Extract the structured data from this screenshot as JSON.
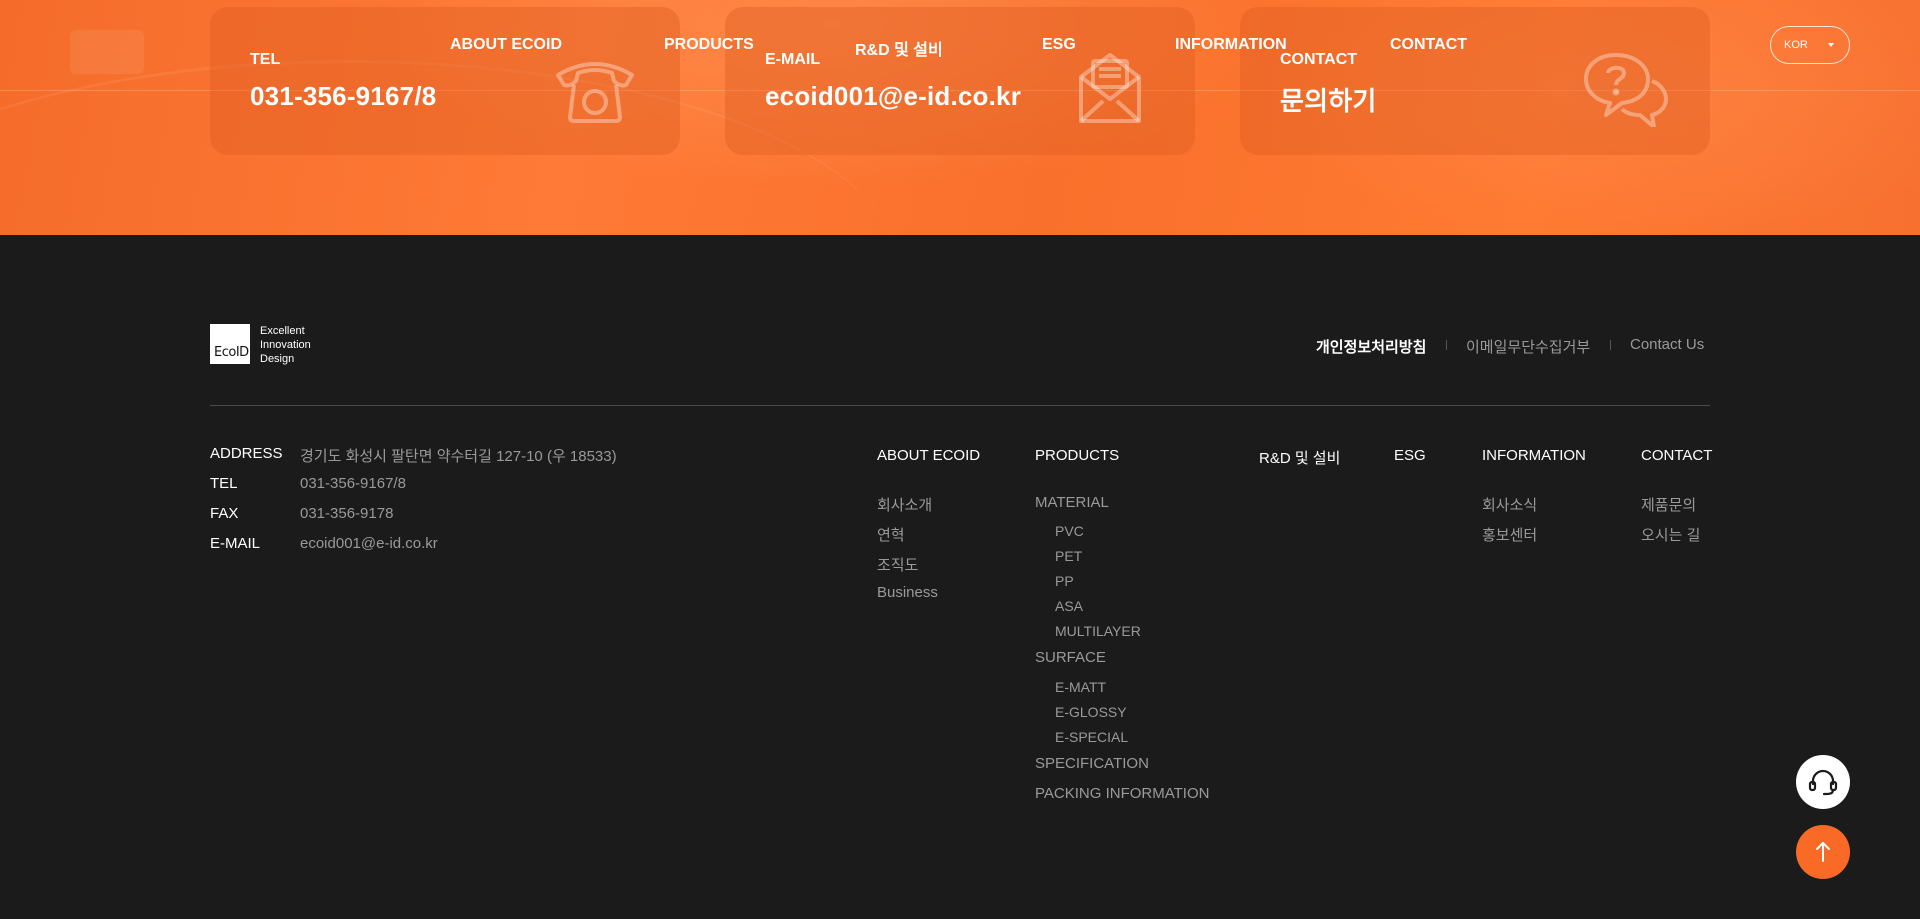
{
  "hero": {
    "cards": [
      {
        "label": "TEL",
        "value": "031-356-9167/8",
        "icon": "phone-icon"
      },
      {
        "label": "E-MAIL",
        "value": "ecoid001@e-id.co.kr",
        "icon": "mail-icon"
      },
      {
        "label": "CONTACT",
        "value": "문의하기",
        "icon": "chat-question-icon"
      }
    ]
  },
  "nav": {
    "items": [
      "ABOUT ECOID",
      "PRODUCTS",
      "R&D 및 설비",
      "ESG",
      "INFORMATION",
      "CONTACT"
    ],
    "lang": "KOR"
  },
  "footer": {
    "logo_text": "EcoID",
    "tagline": [
      "Excellent",
      "Innovation",
      "Design"
    ],
    "policies": [
      "개인정보처리방침",
      "이메일무단수집거부",
      "Contact Us"
    ],
    "info": [
      {
        "key": "ADDRESS",
        "value": "경기도 화성시 팔탄면 약수터길 127-10 (우 18533)"
      },
      {
        "key": "TEL",
        "value": "031-356-9167/8"
      },
      {
        "key": "FAX",
        "value": "031-356-9178"
      },
      {
        "key": "E-MAIL",
        "value": "ecoid001@e-id.co.kr"
      }
    ],
    "menu": {
      "about": {
        "title": "ABOUT ECOID",
        "items": [
          "회사소개",
          "연혁",
          "조직도",
          "Business"
        ]
      },
      "products": {
        "title": "PRODUCTS",
        "material": "MATERIAL",
        "material_items": [
          "PVC",
          "PET",
          "PP",
          "ASA",
          "MULTILAYER"
        ],
        "surface": "SURFACE",
        "surface_items": [
          "E-MATT",
          "E-GLOSSY",
          "E-SPECIAL"
        ],
        "specification": "SPECIFICATION",
        "packing": "PACKING INFORMATION"
      },
      "rnd": {
        "title": "R&D 및 설비"
      },
      "esg": {
        "title": "ESG"
      },
      "information": {
        "title": "INFORMATION",
        "items": [
          "회사소식",
          "홍보센터"
        ]
      },
      "contact": {
        "title": "CONTACT",
        "items": [
          "제품문의",
          "오시는 길"
        ]
      }
    }
  },
  "floating": {
    "support_icon": "headset-icon",
    "top_icon": "arrow-up-icon"
  },
  "colors": {
    "accent": "#f86a25",
    "footer_bg": "#1b1b1b"
  }
}
